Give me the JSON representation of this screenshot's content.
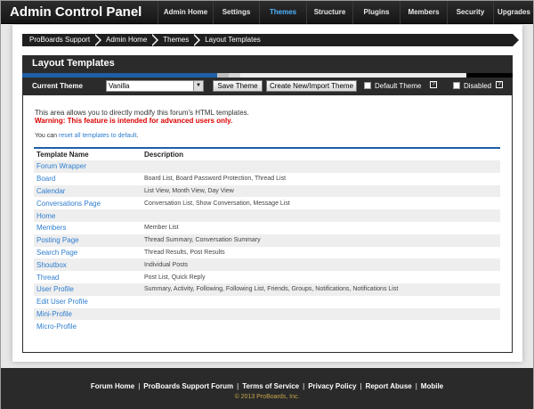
{
  "header": {
    "title": "Admin Control Panel",
    "nav": [
      {
        "label": "Admin Home",
        "name": "nav-admin-home",
        "active": false,
        "w": 62
      },
      {
        "label": "Settings",
        "name": "nav-settings",
        "active": false,
        "w": 52
      },
      {
        "label": "Themes",
        "name": "nav-themes",
        "active": true,
        "w": 53
      },
      {
        "label": "Structure",
        "name": "nav-structure",
        "active": false,
        "w": 52
      },
      {
        "label": "Plugins",
        "name": "nav-plugins",
        "active": false,
        "w": 53
      },
      {
        "label": "Members",
        "name": "nav-members",
        "active": false,
        "w": 53
      },
      {
        "label": "Security",
        "name": "nav-security",
        "active": false,
        "w": 52
      },
      {
        "label": "Upgrades",
        "name": "nav-upgrades",
        "active": false,
        "w": 46
      }
    ]
  },
  "breadcrumb": [
    "ProBoards Support",
    "Admin Home",
    "Themes",
    "Layout Templates"
  ],
  "panel": {
    "title": "Layout Templates",
    "current_theme_label": "Current Theme",
    "theme_value": "Vanilla",
    "save_label": "Save Theme",
    "create_label": "Create New/Import Theme",
    "default_label": "Default Theme",
    "disabled_label": "Disabled",
    "help": "?"
  },
  "content": {
    "intro": "This area allows you to directly modify this forum's HTML templates.",
    "warning": "Warning: This feature is intended for advanced users only.",
    "reset_prefix": "You can ",
    "reset_link": "reset all templates to default",
    "reset_suffix": "."
  },
  "table": {
    "col_name": "Template Name",
    "col_desc": "Description",
    "rows": [
      {
        "name": "Forum Wrapper",
        "desc": ""
      },
      {
        "name": "Board",
        "desc": "Board List, Board Password Protection, Thread List"
      },
      {
        "name": "Calendar",
        "desc": "List View, Month View, Day View"
      },
      {
        "name": "Conversations Page",
        "desc": "Conversation List, Show Conversation, Message List"
      },
      {
        "name": "Home",
        "desc": ""
      },
      {
        "name": "Members",
        "desc": "Member List"
      },
      {
        "name": "Posting Page",
        "desc": "Thread Summary, Conversation Summary"
      },
      {
        "name": "Search Page",
        "desc": "Thread Results, Post Results"
      },
      {
        "name": "Shoutbox",
        "desc": "Individual Posts"
      },
      {
        "name": "Thread",
        "desc": "Post List, Quick Reply"
      },
      {
        "name": "User Profile",
        "desc": "Summary, Activity, Following, Following List, Friends, Groups, Notifications, Notifications List"
      },
      {
        "name": "Edit User Profile",
        "desc": ""
      },
      {
        "name": "Mini-Profile",
        "desc": ""
      },
      {
        "name": "Micro-Profile",
        "desc": ""
      }
    ]
  },
  "footer": {
    "links": [
      "Forum Home",
      "ProBoards Support Forum",
      "Terms of Service",
      "Privacy Policy",
      "Report Abuse",
      "Mobile"
    ],
    "copyright": "© 2013 ProBoards, Inc."
  },
  "colors": {
    "accent_blue": "#1f5ea8",
    "link": "#2e7ecf",
    "warning": "#dd0000",
    "active_nav": "#4cb4ff"
  }
}
